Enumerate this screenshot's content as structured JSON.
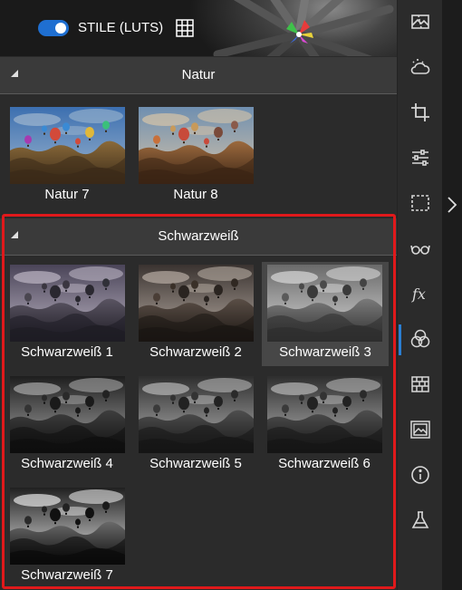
{
  "topbar": {
    "toggle_on": true,
    "label": "STILE (LUTS)"
  },
  "categories": [
    {
      "name": "Natur",
      "items": [
        {
          "label": "Natur 7",
          "style": "color"
        },
        {
          "label": "Natur 8",
          "style": "warm"
        }
      ]
    },
    {
      "name": "Schwarzweiß",
      "items": [
        {
          "label": "Schwarzweiß 1",
          "style": "bw-purple"
        },
        {
          "label": "Schwarzweiß 2",
          "style": "bw-brown"
        },
        {
          "label": "Schwarzweiß 3",
          "style": "bw-light",
          "selected": true
        },
        {
          "label": "Schwarzweiß 4",
          "style": "bw-dark"
        },
        {
          "label": "Schwarzweiß 5",
          "style": "bw-neutral"
        },
        {
          "label": "Schwarzweiß 6",
          "style": "bw-neutral"
        },
        {
          "label": "Schwarzweiß 7",
          "style": "bw-contrast"
        }
      ]
    }
  ],
  "sidebar": {
    "icons": [
      "image-landscape-icon",
      "weather-icon",
      "crop-icon",
      "sliders-icon",
      "selection-icon",
      "glasses-icon",
      "fx-icon",
      "color-circles-icon",
      "texture-icon",
      "frame-image-icon",
      "info-icon",
      "flask-icon"
    ],
    "active": "color-circles-icon"
  },
  "colors": {
    "accent": "#1f6fd1",
    "highlight_frame": "#e0191b"
  }
}
